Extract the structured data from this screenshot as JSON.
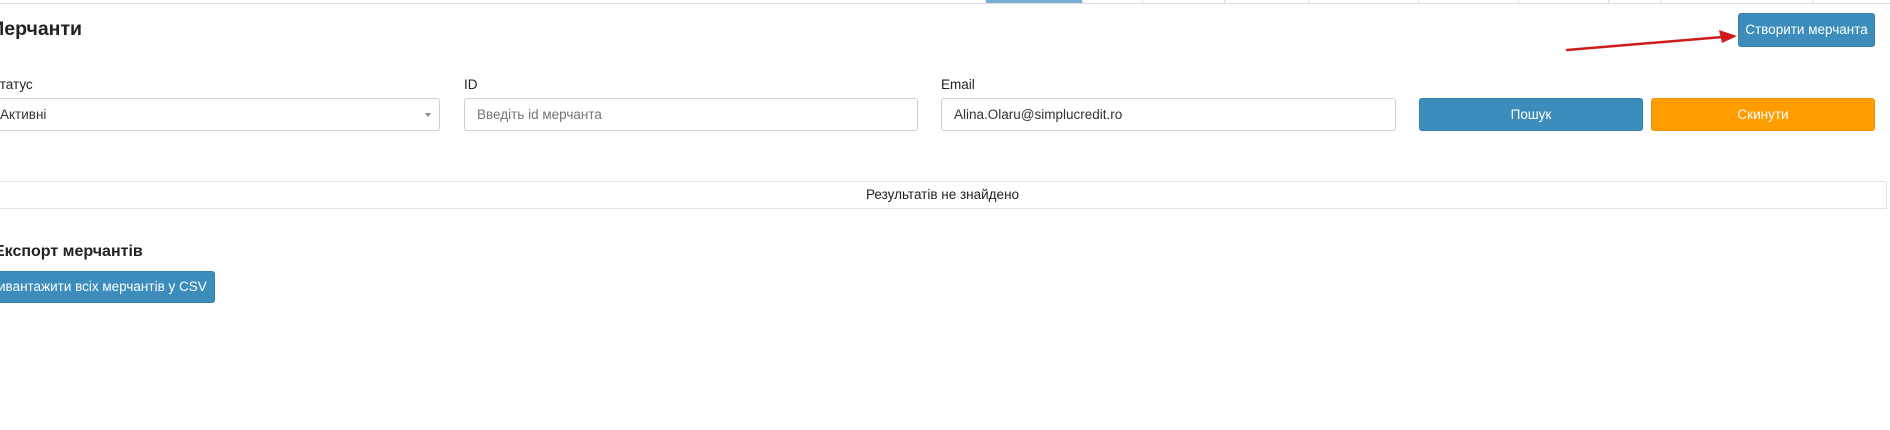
{
  "page": {
    "title": "Мерчанти"
  },
  "toolbar": {
    "create_label": "Створити мерчанта"
  },
  "filters": {
    "status": {
      "label": "Статус",
      "value": "Активні"
    },
    "id": {
      "label": "ID",
      "value": "",
      "placeholder": "Введіть id мерчанта"
    },
    "email": {
      "label": "Email",
      "value": "Alina.Olaru@simplucredit.ro",
      "placeholder": ""
    },
    "search_label": "Пошук",
    "reset_label": "Скинути"
  },
  "results": {
    "empty_text": "Результатів не знайдено"
  },
  "export": {
    "title": "Експорт мерчантів",
    "button_label": "Вивантажити всіх мерчантів у CSV"
  },
  "colors": {
    "primary": "#3c8dbc",
    "warning": "#ff9c00",
    "annotation_arrow": "#d11a1a"
  }
}
